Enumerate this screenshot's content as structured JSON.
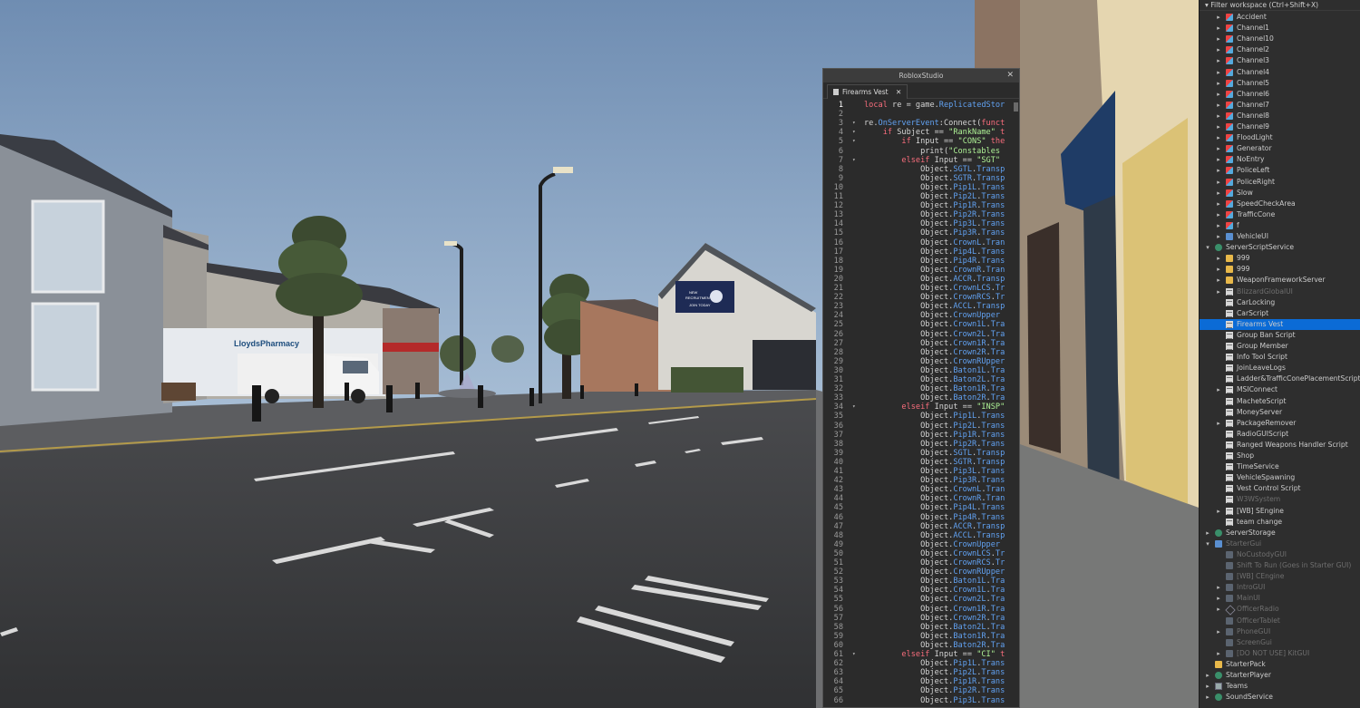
{
  "editor": {
    "window_title": "RobloxStudio",
    "tab_label": "Firearms Vest",
    "lines": [
      {
        "n": "1",
        "fold": "",
        "html": "<span class='kw'>local</span> re = game.<span class='prop'>ReplicatedStor</span>"
      },
      {
        "n": "2",
        "fold": "",
        "html": ""
      },
      {
        "n": "3",
        "fold": "▾",
        "html": "re.<span class='prop'>OnServerEvent</span>:Connect(<span class='kw'>funct</span>"
      },
      {
        "n": "4",
        "fold": "▾",
        "html": "    <span class='kw'>if</span> Subject == <span class='str'>\"RankName\"</span> <span class='kw'>t</span>"
      },
      {
        "n": "5",
        "fold": "▾",
        "html": "        <span class='kw'>if</span> Input == <span class='str'>\"CONS\"</span> <span class='kw'>the</span>"
      },
      {
        "n": "6",
        "fold": "",
        "html": "            print(<span class='str'>\"Constables</span>"
      },
      {
        "n": "7",
        "fold": "▾",
        "html": "        <span class='kw'>elseif</span> Input == <span class='str'>\"SGT\"</span>"
      },
      {
        "n": "8",
        "fold": "",
        "html": "            Object.<span class='prop'>SGTL</span>.<span class='prop'>Transp</span>"
      },
      {
        "n": "9",
        "fold": "",
        "html": "            Object.<span class='prop'>SGTR</span>.<span class='prop'>Transp</span>"
      },
      {
        "n": "10",
        "fold": "",
        "html": "            Object.<span class='prop'>Pip1L</span>.<span class='prop'>Trans</span>"
      },
      {
        "n": "11",
        "fold": "",
        "html": "            Object.<span class='prop'>Pip2L</span>.<span class='prop'>Trans</span>"
      },
      {
        "n": "12",
        "fold": "",
        "html": "            Object.<span class='prop'>Pip1R</span>.<span class='prop'>Trans</span>"
      },
      {
        "n": "13",
        "fold": "",
        "html": "            Object.<span class='prop'>Pip2R</span>.<span class='prop'>Trans</span>"
      },
      {
        "n": "14",
        "fold": "",
        "html": "            Object.<span class='prop'>Pip3L</span>.<span class='prop'>Trans</span>"
      },
      {
        "n": "15",
        "fold": "",
        "html": "            Object.<span class='prop'>Pip3R</span>.<span class='prop'>Trans</span>"
      },
      {
        "n": "16",
        "fold": "",
        "html": "            Object.<span class='prop'>CrownL</span>.<span class='prop'>Tran</span>"
      },
      {
        "n": "17",
        "fold": "",
        "html": "            Object.<span class='prop'>Pip4L</span>.<span class='prop'>Trans</span>"
      },
      {
        "n": "18",
        "fold": "",
        "html": "            Object.<span class='prop'>Pip4R</span>.<span class='prop'>Trans</span>"
      },
      {
        "n": "19",
        "fold": "",
        "html": "            Object.<span class='prop'>CrownR</span>.<span class='prop'>Tran</span>"
      },
      {
        "n": "20",
        "fold": "",
        "html": "            Object.<span class='prop'>ACCR</span>.<span class='prop'>Transp</span>"
      },
      {
        "n": "21",
        "fold": "",
        "html": "            Object.<span class='prop'>CrownLCS</span>.<span class='prop'>Tr</span>"
      },
      {
        "n": "22",
        "fold": "",
        "html": "            Object.<span class='prop'>CrownRCS</span>.<span class='prop'>Tr</span>"
      },
      {
        "n": "23",
        "fold": "",
        "html": "            Object.<span class='prop'>ACCL</span>.<span class='prop'>Transp</span>"
      },
      {
        "n": "24",
        "fold": "",
        "html": "            Object.<span class='prop'>CrownUpper</span>"
      },
      {
        "n": "25",
        "fold": "",
        "html": "            Object.<span class='prop'>Crown1L</span>.<span class='prop'>Tra</span>"
      },
      {
        "n": "26",
        "fold": "",
        "html": "            Object.<span class='prop'>Crown2L</span>.<span class='prop'>Tra</span>"
      },
      {
        "n": "27",
        "fold": "",
        "html": "            Object.<span class='prop'>Crown1R</span>.<span class='prop'>Tra</span>"
      },
      {
        "n": "28",
        "fold": "",
        "html": "            Object.<span class='prop'>Crown2R</span>.<span class='prop'>Tra</span>"
      },
      {
        "n": "29",
        "fold": "",
        "html": "            Object.<span class='prop'>CrownRUpper</span>"
      },
      {
        "n": "30",
        "fold": "",
        "html": "            Object.<span class='prop'>Baton1L</span>.<span class='prop'>Tra</span>"
      },
      {
        "n": "31",
        "fold": "",
        "html": "            Object.<span class='prop'>Baton2L</span>.<span class='prop'>Tra</span>"
      },
      {
        "n": "32",
        "fold": "",
        "html": "            Object.<span class='prop'>Baton1R</span>.<span class='prop'>Tra</span>"
      },
      {
        "n": "33",
        "fold": "",
        "html": "            Object.<span class='prop'>Baton2R</span>.<span class='prop'>Tra</span>"
      },
      {
        "n": "34",
        "fold": "▾",
        "html": "        <span class='kw'>elseif</span> Input == <span class='str'>\"INSP\"</span>"
      },
      {
        "n": "35",
        "fold": "",
        "html": "            Object.<span class='prop'>Pip1L</span>.<span class='prop'>Trans</span>"
      },
      {
        "n": "36",
        "fold": "",
        "html": "            Object.<span class='prop'>Pip2L</span>.<span class='prop'>Trans</span>"
      },
      {
        "n": "37",
        "fold": "",
        "html": "            Object.<span class='prop'>Pip1R</span>.<span class='prop'>Trans</span>"
      },
      {
        "n": "38",
        "fold": "",
        "html": "            Object.<span class='prop'>Pip2R</span>.<span class='prop'>Trans</span>"
      },
      {
        "n": "39",
        "fold": "",
        "html": "            Object.<span class='prop'>SGTL</span>.<span class='prop'>Transp</span>"
      },
      {
        "n": "40",
        "fold": "",
        "html": "            Object.<span class='prop'>SGTR</span>.<span class='prop'>Transp</span>"
      },
      {
        "n": "41",
        "fold": "",
        "html": "            Object.<span class='prop'>Pip3L</span>.<span class='prop'>Trans</span>"
      },
      {
        "n": "42",
        "fold": "",
        "html": "            Object.<span class='prop'>Pip3R</span>.<span class='prop'>Trans</span>"
      },
      {
        "n": "43",
        "fold": "",
        "html": "            Object.<span class='prop'>CrownL</span>.<span class='prop'>Tran</span>"
      },
      {
        "n": "44",
        "fold": "",
        "html": "            Object.<span class='prop'>CrownR</span>.<span class='prop'>Tran</span>"
      },
      {
        "n": "45",
        "fold": "",
        "html": "            Object.<span class='prop'>Pip4L</span>.<span class='prop'>Trans</span>"
      },
      {
        "n": "46",
        "fold": "",
        "html": "            Object.<span class='prop'>Pip4R</span>.<span class='prop'>Trans</span>"
      },
      {
        "n": "47",
        "fold": "",
        "html": "            Object.<span class='prop'>ACCR</span>.<span class='prop'>Transp</span>"
      },
      {
        "n": "48",
        "fold": "",
        "html": "            Object.<span class='prop'>ACCL</span>.<span class='prop'>Transp</span>"
      },
      {
        "n": "49",
        "fold": "",
        "html": "            Object.<span class='prop'>CrownUpper</span>"
      },
      {
        "n": "50",
        "fold": "",
        "html": "            Object.<span class='prop'>CrownLCS</span>.<span class='prop'>Tr</span>"
      },
      {
        "n": "51",
        "fold": "",
        "html": "            Object.<span class='prop'>CrownRCS</span>.<span class='prop'>Tr</span>"
      },
      {
        "n": "52",
        "fold": "",
        "html": "            Object.<span class='prop'>CrownRUpper</span>"
      },
      {
        "n": "53",
        "fold": "",
        "html": "            Object.<span class='prop'>Baton1L</span>.<span class='prop'>Tra</span>"
      },
      {
        "n": "54",
        "fold": "",
        "html": "            Object.<span class='prop'>Crown1L</span>.<span class='prop'>Tra</span>"
      },
      {
        "n": "55",
        "fold": "",
        "html": "            Object.<span class='prop'>Crown2L</span>.<span class='prop'>Tra</span>"
      },
      {
        "n": "56",
        "fold": "",
        "html": "            Object.<span class='prop'>Crown1R</span>.<span class='prop'>Tra</span>"
      },
      {
        "n": "57",
        "fold": "",
        "html": "            Object.<span class='prop'>Crown2R</span>.<span class='prop'>Tra</span>"
      },
      {
        "n": "58",
        "fold": "",
        "html": "            Object.<span class='prop'>Baton2L</span>.<span class='prop'>Tra</span>"
      },
      {
        "n": "59",
        "fold": "",
        "html": "            Object.<span class='prop'>Baton1R</span>.<span class='prop'>Tra</span>"
      },
      {
        "n": "60",
        "fold": "",
        "html": "            Object.<span class='prop'>Baton2R</span>.<span class='prop'>Tra</span>"
      },
      {
        "n": "61",
        "fold": "▾",
        "html": "        <span class='kw'>elseif</span> Input == <span class='str'>\"CI\"</span> <span class='kw'>t</span>"
      },
      {
        "n": "62",
        "fold": "",
        "html": "            Object.<span class='prop'>Pip1L</span>.<span class='prop'>Trans</span>"
      },
      {
        "n": "63",
        "fold": "",
        "html": "            Object.<span class='prop'>Pip2L</span>.<span class='prop'>Trans</span>"
      },
      {
        "n": "64",
        "fold": "",
        "html": "            Object.<span class='prop'>Pip1R</span>.<span class='prop'>Trans</span>"
      },
      {
        "n": "65",
        "fold": "",
        "html": "            Object.<span class='prop'>Pip2R</span>.<span class='prop'>Trans</span>"
      },
      {
        "n": "66",
        "fold": "",
        "html": "            Object.<span class='prop'>Pip3L</span>.<span class='prop'>Trans</span>"
      }
    ]
  },
  "explorer": {
    "filter_placeholder": "Filter workspace (Ctrl+Shift+X)",
    "items": [
      {
        "label": "Accident",
        "indent": 2,
        "arrow": "▸",
        "icon": "part",
        "dim": false
      },
      {
        "label": "Channel1",
        "indent": 2,
        "arrow": "▸",
        "icon": "part",
        "dim": false
      },
      {
        "label": "Channel10",
        "indent": 2,
        "arrow": "▸",
        "icon": "part",
        "dim": false
      },
      {
        "label": "Channel2",
        "indent": 2,
        "arrow": "▸",
        "icon": "part",
        "dim": false
      },
      {
        "label": "Channel3",
        "indent": 2,
        "arrow": "▸",
        "icon": "part",
        "dim": false
      },
      {
        "label": "Channel4",
        "indent": 2,
        "arrow": "▸",
        "icon": "part",
        "dim": false
      },
      {
        "label": "Channel5",
        "indent": 2,
        "arrow": "▸",
        "icon": "part",
        "dim": false
      },
      {
        "label": "Channel6",
        "indent": 2,
        "arrow": "▸",
        "icon": "part",
        "dim": false
      },
      {
        "label": "Channel7",
        "indent": 2,
        "arrow": "▸",
        "icon": "part",
        "dim": false
      },
      {
        "label": "Channel8",
        "indent": 2,
        "arrow": "▸",
        "icon": "part",
        "dim": false
      },
      {
        "label": "Channel9",
        "indent": 2,
        "arrow": "▸",
        "icon": "part",
        "dim": false
      },
      {
        "label": "FloodLight",
        "indent": 2,
        "arrow": "▸",
        "icon": "part",
        "dim": false
      },
      {
        "label": "Generator",
        "indent": 2,
        "arrow": "▸",
        "icon": "part",
        "dim": false
      },
      {
        "label": "NoEntry",
        "indent": 2,
        "arrow": "▸",
        "icon": "part",
        "dim": false
      },
      {
        "label": "PoliceLeft",
        "indent": 2,
        "arrow": "▸",
        "icon": "part",
        "dim": false
      },
      {
        "label": "PoliceRight",
        "indent": 2,
        "arrow": "▸",
        "icon": "part",
        "dim": false
      },
      {
        "label": "Slow",
        "indent": 2,
        "arrow": "▸",
        "icon": "part",
        "dim": false
      },
      {
        "label": "SpeedCheckArea",
        "indent": 2,
        "arrow": "▸",
        "icon": "part",
        "dim": false
      },
      {
        "label": "TrafficCone",
        "indent": 2,
        "arrow": "▸",
        "icon": "part",
        "dim": false
      },
      {
        "label": "f",
        "indent": 2,
        "arrow": "▸",
        "icon": "part",
        "dim": false
      },
      {
        "label": "VehicleUI",
        "indent": 2,
        "arrow": "▸",
        "icon": "gui",
        "dim": false
      },
      {
        "label": "ServerScriptService",
        "indent": 1,
        "arrow": "▾",
        "icon": "svc",
        "dim": false
      },
      {
        "label": "999",
        "indent": 2,
        "arrow": "▸",
        "icon": "folder",
        "dim": false
      },
      {
        "label": "999",
        "indent": 2,
        "arrow": "▸",
        "icon": "folder",
        "dim": false
      },
      {
        "label": "WeaponFrameworkServer",
        "indent": 2,
        "arrow": "▸",
        "icon": "folder",
        "dim": false
      },
      {
        "label": "BlizzardGlobalUI",
        "indent": 2,
        "arrow": "▸",
        "icon": "script",
        "dim": true
      },
      {
        "label": "CarLocking",
        "indent": 2,
        "arrow": "",
        "icon": "script",
        "dim": false
      },
      {
        "label": "CarScript",
        "indent": 2,
        "arrow": "",
        "icon": "script",
        "dim": false
      },
      {
        "label": "Firearms Vest",
        "indent": 2,
        "arrow": "",
        "icon": "script",
        "dim": false,
        "selected": true
      },
      {
        "label": "Group Ban Script",
        "indent": 2,
        "arrow": "",
        "icon": "script",
        "dim": false
      },
      {
        "label": "Group Member",
        "indent": 2,
        "arrow": "",
        "icon": "script",
        "dim": false
      },
      {
        "label": "Info Tool Script",
        "indent": 2,
        "arrow": "",
        "icon": "script",
        "dim": false
      },
      {
        "label": "JoinLeaveLogs",
        "indent": 2,
        "arrow": "",
        "icon": "script",
        "dim": false
      },
      {
        "label": "Ladder&TrafficConePlacementScript",
        "indent": 2,
        "arrow": "",
        "icon": "script",
        "dim": false
      },
      {
        "label": "MSIConnect",
        "indent": 2,
        "arrow": "▸",
        "icon": "script",
        "dim": false
      },
      {
        "label": "MacheteScript",
        "indent": 2,
        "arrow": "",
        "icon": "script",
        "dim": false
      },
      {
        "label": "MoneyServer",
        "indent": 2,
        "arrow": "",
        "icon": "script",
        "dim": false
      },
      {
        "label": "PackageRemover",
        "indent": 2,
        "arrow": "▸",
        "icon": "script",
        "dim": false
      },
      {
        "label": "RadioGUIScript",
        "indent": 2,
        "arrow": "",
        "icon": "script",
        "dim": false
      },
      {
        "label": "Ranged Weapons Handler Script",
        "indent": 2,
        "arrow": "",
        "icon": "script",
        "dim": false
      },
      {
        "label": "Shop",
        "indent": 2,
        "arrow": "",
        "icon": "script",
        "dim": false
      },
      {
        "label": "TimeService",
        "indent": 2,
        "arrow": "",
        "icon": "script",
        "dim": false
      },
      {
        "label": "VehicleSpawning",
        "indent": 2,
        "arrow": "",
        "icon": "script",
        "dim": false
      },
      {
        "label": "Vest Control Script",
        "indent": 2,
        "arrow": "",
        "icon": "script",
        "dim": false
      },
      {
        "label": "W3WSystem",
        "indent": 2,
        "arrow": "",
        "icon": "script",
        "dim": true
      },
      {
        "label": "[WB] SEngine",
        "indent": 2,
        "arrow": "▸",
        "icon": "script",
        "dim": false
      },
      {
        "label": "team change",
        "indent": 2,
        "arrow": "",
        "icon": "script",
        "dim": false
      },
      {
        "label": "ServerStorage",
        "indent": 1,
        "arrow": "▸",
        "icon": "svc",
        "dim": false
      },
      {
        "label": "StarterGui",
        "indent": 1,
        "arrow": "▾",
        "icon": "gui",
        "dim": true
      },
      {
        "label": "NoCustodyGUI",
        "indent": 2,
        "arrow": "",
        "icon": "dimico",
        "dim": true
      },
      {
        "label": "Shift To Run (Goes in Starter GUI)",
        "indent": 2,
        "arrow": "",
        "icon": "dimico",
        "dim": true
      },
      {
        "label": "[WB] CEngine",
        "indent": 2,
        "arrow": "",
        "icon": "dimico",
        "dim": true
      },
      {
        "label": "IntroGUI",
        "indent": 2,
        "arrow": "▸",
        "icon": "dimico",
        "dim": true
      },
      {
        "label": "MainUI",
        "indent": 2,
        "arrow": "▸",
        "icon": "dimico",
        "dim": true
      },
      {
        "label": "OfficerRadio",
        "indent": 2,
        "arrow": "▸",
        "icon": "diamond",
        "dim": true
      },
      {
        "label": "OfficerTablet",
        "indent": 2,
        "arrow": "",
        "icon": "dimico",
        "dim": true
      },
      {
        "label": "PhoneGUI",
        "indent": 2,
        "arrow": "▸",
        "icon": "dimico",
        "dim": true
      },
      {
        "label": "ScreenGui",
        "indent": 2,
        "arrow": "",
        "icon": "dimico",
        "dim": true
      },
      {
        "label": "[DO NOT USE] KitGUI",
        "indent": 2,
        "arrow": "▸",
        "icon": "dimico",
        "dim": true
      },
      {
        "label": "StarterPack",
        "indent": 1,
        "arrow": "",
        "icon": "folder",
        "dim": false
      },
      {
        "label": "StarterPlayer",
        "indent": 1,
        "arrow": "▸",
        "icon": "svc",
        "dim": false
      },
      {
        "label": "Teams",
        "indent": 1,
        "arrow": "▸",
        "icon": "model",
        "dim": false
      },
      {
        "label": "SoundService",
        "indent": 1,
        "arrow": "▸",
        "icon": "svc",
        "dim": false
      }
    ]
  },
  "viewport": {
    "shop_sign": "LloydsPharmacy",
    "billboard_line1": "NEW",
    "billboard_line2": "RECRUITMENT",
    "billboard_line3": "JOIN TODAY"
  }
}
